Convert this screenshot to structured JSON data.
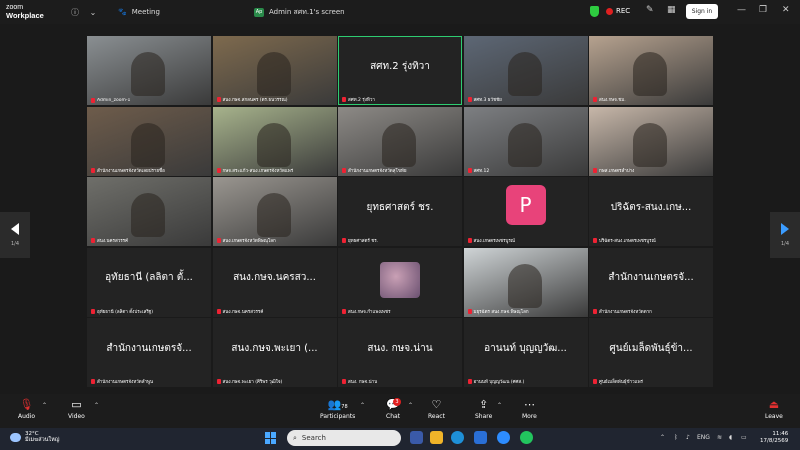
{
  "titlebar": {
    "app_line1": "zoom",
    "app_line2": "Workplace",
    "info_icon": "ⓘ",
    "chevron": "⌄",
    "tab_meeting": "Meeting",
    "tab_share_logo": "Ap",
    "tab_share": "Admin สศท.1's screen",
    "rec_label": "REC",
    "signin_label": "Sign in"
  },
  "tiles": [
    {
      "row": 0,
      "col": 0,
      "name": "Admin_zoom-1",
      "type": "video",
      "bg": "#8a8f92"
    },
    {
      "row": 0,
      "col": 1,
      "name": "สนง.กษจ.สกลนคร (ดร.ธนวรรณ)",
      "type": "video",
      "bg": "#7e6a4e"
    },
    {
      "row": 0,
      "col": 2,
      "name": "สศท.2 รุ่งทิวา",
      "type": "text",
      "big": "สศท.2 รุ่งทิวา",
      "active": true
    },
    {
      "row": 0,
      "col": 3,
      "name": "สศท.3 ธวัชชัย",
      "type": "video",
      "bg": "#5d6775"
    },
    {
      "row": 0,
      "col": 4,
      "name": "สนง.กษจ.ชม.",
      "type": "video",
      "bg": "#b6a28f"
    },
    {
      "row": 1,
      "col": 0,
      "name": "สำนักงานเกษตรจังหวัดเลยปรายชื่อ",
      "type": "video",
      "bg": "#6e5c4b"
    },
    {
      "row": 1,
      "col": 1,
      "name": "กษจ.สระแก้ว-สนง.เกษตรจังหวัดแพร่",
      "type": "video",
      "bg": "#a7b38c"
    },
    {
      "row": 1,
      "col": 2,
      "name": "สำนักงานเกษตรจังหวัดสุโขทัย",
      "type": "video",
      "bg": "#8d8a86"
    },
    {
      "row": 1,
      "col": 3,
      "name": "สศท.12",
      "type": "video",
      "bg": "#7d7f82"
    },
    {
      "row": 1,
      "col": 4,
      "name": "กษส.เกษตรลำปาง",
      "type": "video",
      "bg": "#c7b7a9"
    },
    {
      "row": 2,
      "col": 0,
      "name": "สนง.นครสวรรค์",
      "type": "video",
      "bg": "#6f6f6a"
    },
    {
      "row": 2,
      "col": 1,
      "name": "สนง.เกษตรจังหวัดพิษณุโลก",
      "type": "video",
      "bg": "#9a9690"
    },
    {
      "row": 2,
      "col": 2,
      "name": "ยุทธศาสตร์ ชร.",
      "type": "text",
      "big": "ยุทธศาสตร์ ชร."
    },
    {
      "row": 2,
      "col": 3,
      "name": "สนง.เกษตรเพชรบูรณ์",
      "type": "avatar",
      "big": "P"
    },
    {
      "row": 2,
      "col": 4,
      "name": "ปริฉัตร-สนง.เกษตรเพชรบูรณ์",
      "type": "text",
      "big": "ปริฉัตร-สนง.เกษ..."
    },
    {
      "row": 3,
      "col": 0,
      "name": "อุทัยธานี (ลลิตา ตั้งประเสริฐ)",
      "type": "text",
      "big": "อุทัยธานี (ลลิตา ตั้..."
    },
    {
      "row": 3,
      "col": 1,
      "name": "สนง.กษจ.นครสวรรค์",
      "type": "text",
      "big": "สนง.กษจ.นครสว..."
    },
    {
      "row": 3,
      "col": 2,
      "name": "สนง.กษจ.กำแพงเพชร",
      "type": "thumb"
    },
    {
      "row": 3,
      "col": 3,
      "name": "มยุรฉัตร สนง.กษจ.พิษณุโลก",
      "type": "video",
      "bg": "#cfd4d6"
    },
    {
      "row": 3,
      "col": 4,
      "name": "สำนักงานเกษตรจังหวัดตาก",
      "type": "text",
      "big": "สำนักงานเกษตรจั..."
    },
    {
      "row": 4,
      "col": 0,
      "name": "สำนักงานเกษตรจังหวัดลำพูน",
      "type": "text",
      "big": "สำนักงานเกษตรจั..."
    },
    {
      "row": 4,
      "col": 1,
      "name": "สนง.กษจ.พะเยา (ศิริพร วุฒิใจ)",
      "type": "text",
      "big": "สนง.กษจ.พะเยา (..."
    },
    {
      "row": 4,
      "col": 2,
      "name": "สนง. กษจ.น่าน",
      "type": "text",
      "big": "สนง. กษจ.น่าน"
    },
    {
      "row": 4,
      "col": 3,
      "name": "อานนท์ บุญญวัฒน (ศศส.)",
      "type": "text",
      "big": "อานนท์ บุญญวัฒ..."
    },
    {
      "row": 4,
      "col": 4,
      "name": "ศูนย์เมล็ดพันธุ์ข้าวแพร่",
      "type": "text",
      "big": "ศูนย์เมล็ดพันธุ์ข้า..."
    }
  ],
  "pager": {
    "left": "1/4",
    "right": "1/4"
  },
  "toolbar": {
    "audio": "Audio",
    "video": "Video",
    "participants": "Participants",
    "participants_count": "78",
    "chat": "Chat",
    "chat_badge": "3",
    "react": "React",
    "share": "Share",
    "more": "More",
    "leave": "Leave"
  },
  "taskbar": {
    "temp": "32°C",
    "weather": "มีเมฆส่วนใหญ่",
    "search": "Search",
    "lang": "ENG",
    "time": "11:46",
    "date": "17/8/2569"
  },
  "colors": {
    "active": "#2ecc71",
    "avatar": "#e8437a",
    "record": "#e02020",
    "arrow": "#3b9cff"
  }
}
